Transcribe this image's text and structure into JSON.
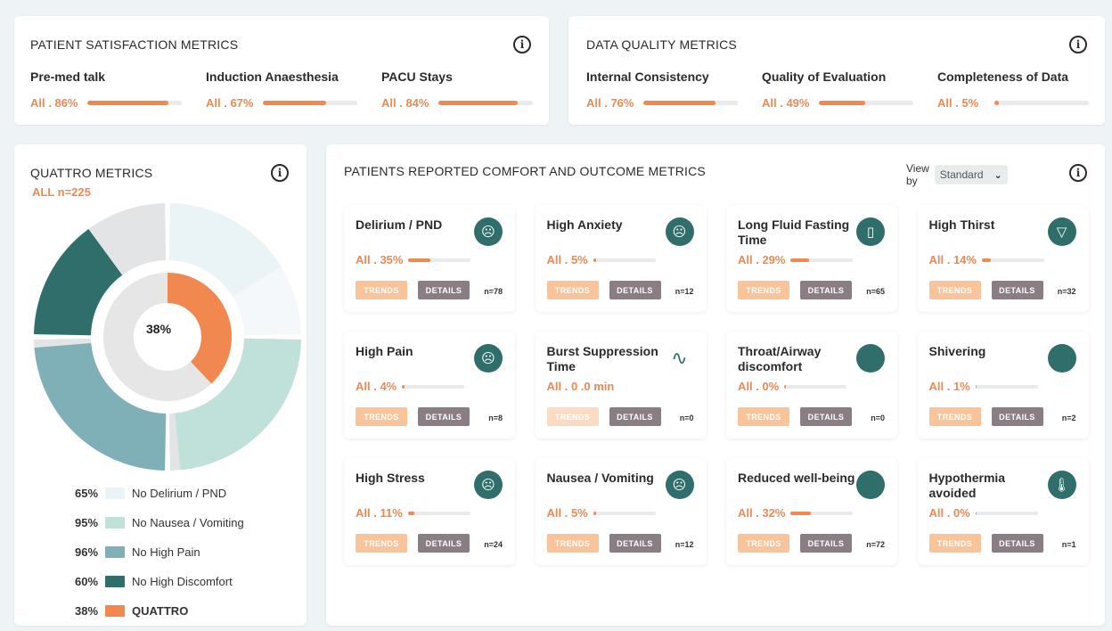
{
  "colors": {
    "accent": "#f08850",
    "teal_dark": "#2f6e6a",
    "teal_mid": "#7fb0b8",
    "mint": "#bfe1d9",
    "pale": "#eaf3f6",
    "grey": "#e2e4e6"
  },
  "satisfaction": {
    "title": "PATIENT SATISFACTION METRICS",
    "metrics": [
      {
        "label": "Pre-med talk",
        "value": "All . 86%",
        "pct": 86
      },
      {
        "label": "Induction Anaesthesia",
        "value": "All . 67%",
        "pct": 67
      },
      {
        "label": "PACU Stays",
        "value": "All . 84%",
        "pct": 84
      }
    ]
  },
  "quality": {
    "title": "DATA QUALITY METRICS",
    "metrics": [
      {
        "label": "Internal Consistency",
        "value": "All . 76%",
        "pct": 76
      },
      {
        "label": "Quality of Evaluation",
        "value": "All . 49%",
        "pct": 49
      },
      {
        "label": "Completeness of Data",
        "value": "All . 5%",
        "pct": 5
      }
    ]
  },
  "quattro": {
    "title": "QUATTRO METRICS",
    "count": "ALL n=225",
    "center": "38%",
    "legend": [
      {
        "pct": "65%",
        "label": "No Delirium / PND",
        "color": "#eaf3f6",
        "value": 65
      },
      {
        "pct": "95%",
        "label": "No Nausea / Vomiting",
        "color": "#bfe1d9",
        "value": 95
      },
      {
        "pct": "96%",
        "label": "No High Pain",
        "color": "#7fb0b8",
        "value": 96
      },
      {
        "pct": "60%",
        "label": "No High Discomfort",
        "color": "#2f6e6a",
        "value": 60
      },
      {
        "pct": "38%",
        "label": "QUATTRO",
        "color": "#f08850",
        "value": 38
      }
    ]
  },
  "outcomes": {
    "title": "PATIENTS REPORTED COMFORT AND OUTCOME METRICS",
    "view_by_label": "View by",
    "view_by_value": "Standard",
    "trends_label": "TRENDS",
    "details_label": "DETAILS",
    "cards": [
      {
        "title": "Delirium / PND",
        "value": "All . 35%",
        "pct": 35,
        "n": "n=78",
        "icon": "confused-face-icon",
        "glyph": "☹"
      },
      {
        "title": "High Anxiety",
        "value": "All . 5%",
        "pct": 5,
        "n": "n=12",
        "icon": "anxious-face-icon",
        "glyph": "☹"
      },
      {
        "title": "Long Fluid Fasting Time",
        "value": "All . 29%",
        "pct": 29,
        "n": "n=65",
        "icon": "water-glass-icon",
        "glyph": "▯"
      },
      {
        "title": "High Thirst",
        "value": "All . 14%",
        "pct": 14,
        "n": "n=32",
        "icon": "cup-icon",
        "glyph": "▽"
      },
      {
        "title": "High Pain",
        "value": "All . 4%",
        "pct": 4,
        "n": "n=8",
        "icon": "pain-face-icon",
        "glyph": "☹"
      },
      {
        "title": "Burst Suppression Time",
        "value": "All . 0 .0 min",
        "pct": 0,
        "n": "n=0",
        "icon": "waveform-icon",
        "glyph": "∿",
        "disabled": true
      },
      {
        "title": "Throat/Airway discomfort",
        "value": "All . 0%",
        "pct": 0,
        "n": "n=0",
        "icon": "throat-icon",
        "glyph": ""
      },
      {
        "title": "Shivering",
        "value": "All . 1%",
        "pct": 1,
        "n": "n=2",
        "icon": "shivering-icon",
        "glyph": ""
      },
      {
        "title": "High Stress",
        "value": "All . 11%",
        "pct": 11,
        "n": "n=24",
        "icon": "stressed-face-icon",
        "glyph": "☹"
      },
      {
        "title": "Nausea / Vomiting",
        "value": "All . 5%",
        "pct": 5,
        "n": "n=12",
        "icon": "nausea-face-icon",
        "glyph": "☹"
      },
      {
        "title": "Reduced well-being",
        "value": "All . 32%",
        "pct": 32,
        "n": "n=72",
        "icon": "wellbeing-icon",
        "glyph": ""
      },
      {
        "title": "Hypothermia avoided",
        "value": "All . 0%",
        "pct": 0,
        "n": "n=1",
        "icon": "thermometer-icon",
        "glyph": "🌡"
      }
    ]
  }
}
